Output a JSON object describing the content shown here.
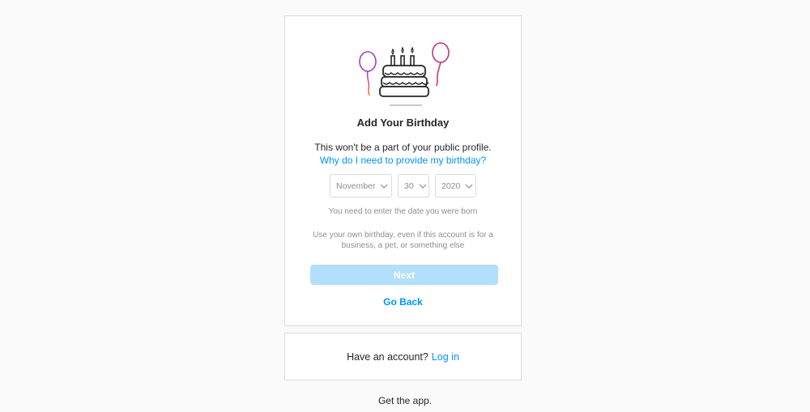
{
  "signup": {
    "title": "Add Your Birthday",
    "subtitle": "This won't be a part of your public profile.",
    "why_link": "Why do I need to provide my birthday?",
    "month": {
      "value": "November"
    },
    "day": {
      "value": "30"
    },
    "year": {
      "value": "2020"
    },
    "hint": "You need to enter the date you were born",
    "note": "Use your own birthday, even if this account is for a business, a pet, or something else",
    "next_label": "Next",
    "back_label": "Go Back"
  },
  "login_card": {
    "text": "Have an account?",
    "link": "Log in"
  },
  "footer": {
    "get_app": "Get the app."
  },
  "icons": {
    "illustration": "birthday-cake-balloons-icon",
    "dropdown": "chevron-down-icon"
  },
  "colors": {
    "link": "#0095f6",
    "next_button_disabled": "#b2dffc",
    "balloon_left": "#b44fd0",
    "balloon_right": "#c13584"
  }
}
